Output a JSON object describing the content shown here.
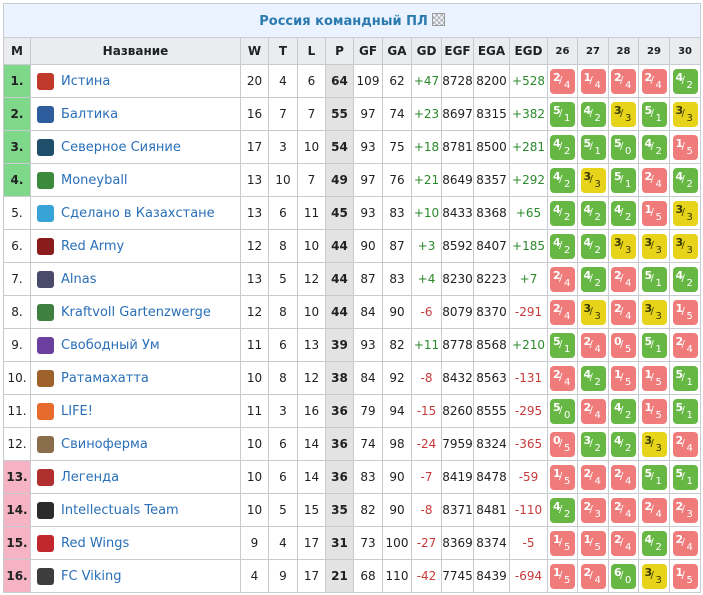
{
  "title": "Россия командный ПЛ",
  "columns": [
    "М",
    "Название",
    "W",
    "T",
    "L",
    "P",
    "GF",
    "GA",
    "GD",
    "EGF",
    "EGA",
    "EGD",
    "26",
    "27",
    "28",
    "29",
    "30"
  ],
  "colors": {
    "win": "#67b744",
    "draw": "#e6d31a",
    "loss": "#ef7b7b",
    "promotion": "#7fd78a",
    "relegation": "#f6b3c4",
    "link": "#2a6fb8"
  },
  "rows": [
    {
      "pos": "1.",
      "zone": "promo",
      "name": "Истина",
      "logo": "#c0392b",
      "W": "20",
      "T": "4",
      "L": "6",
      "P": "64",
      "GF": "109",
      "GA": "62",
      "GD": "+47",
      "EGF": "8728",
      "EGA": "8200",
      "EGD": "+528",
      "results": [
        {
          "a": "2",
          "b": "4",
          "r": "L"
        },
        {
          "a": "1",
          "b": "4",
          "r": "L"
        },
        {
          "a": "2",
          "b": "4",
          "r": "L"
        },
        {
          "a": "2",
          "b": "4",
          "r": "L"
        },
        {
          "a": "4",
          "b": "2",
          "r": "W"
        }
      ]
    },
    {
      "pos": "2.",
      "zone": "promo",
      "name": "Балтика",
      "logo": "#2e5d9e",
      "W": "16",
      "T": "7",
      "L": "7",
      "P": "55",
      "GF": "97",
      "GA": "74",
      "GD": "+23",
      "EGF": "8697",
      "EGA": "8315",
      "EGD": "+382",
      "results": [
        {
          "a": "5",
          "b": "1",
          "r": "W"
        },
        {
          "a": "4",
          "b": "2",
          "r": "W"
        },
        {
          "a": "3",
          "b": "3",
          "r": "D"
        },
        {
          "a": "5",
          "b": "1",
          "r": "W"
        },
        {
          "a": "3",
          "b": "3",
          "r": "D"
        }
      ]
    },
    {
      "pos": "3.",
      "zone": "promo",
      "name": "Северное Сияние",
      "logo": "#1f4f6b",
      "W": "17",
      "T": "3",
      "L": "10",
      "P": "54",
      "GF": "93",
      "GA": "75",
      "GD": "+18",
      "EGF": "8781",
      "EGA": "8500",
      "EGD": "+281",
      "results": [
        {
          "a": "4",
          "b": "2",
          "r": "W"
        },
        {
          "a": "5",
          "b": "1",
          "r": "W"
        },
        {
          "a": "5",
          "b": "0",
          "r": "W"
        },
        {
          "a": "4",
          "b": "2",
          "r": "W"
        },
        {
          "a": "1",
          "b": "5",
          "r": "L"
        }
      ]
    },
    {
      "pos": "4.",
      "zone": "promo",
      "name": "Moneyball",
      "logo": "#3c8a3c",
      "W": "13",
      "T": "10",
      "L": "7",
      "P": "49",
      "GF": "97",
      "GA": "76",
      "GD": "+21",
      "EGF": "8649",
      "EGA": "8357",
      "EGD": "+292",
      "results": [
        {
          "a": "4",
          "b": "2",
          "r": "W"
        },
        {
          "a": "3",
          "b": "3",
          "r": "D"
        },
        {
          "a": "5",
          "b": "1",
          "r": "W"
        },
        {
          "a": "2",
          "b": "4",
          "r": "L"
        },
        {
          "a": "4",
          "b": "2",
          "r": "W"
        }
      ]
    },
    {
      "pos": "5.",
      "zone": "",
      "name": "Сделано в Казахстане",
      "logo": "#37a3d6",
      "W": "13",
      "T": "6",
      "L": "11",
      "P": "45",
      "GF": "93",
      "GA": "83",
      "GD": "+10",
      "EGF": "8433",
      "EGA": "8368",
      "EGD": "+65",
      "results": [
        {
          "a": "4",
          "b": "2",
          "r": "W"
        },
        {
          "a": "4",
          "b": "2",
          "r": "W"
        },
        {
          "a": "4",
          "b": "2",
          "r": "W"
        },
        {
          "a": "1",
          "b": "5",
          "r": "L"
        },
        {
          "a": "3",
          "b": "3",
          "r": "D"
        }
      ]
    },
    {
      "pos": "6.",
      "zone": "",
      "name": "Red Army",
      "logo": "#8a1c1c",
      "W": "12",
      "T": "8",
      "L": "10",
      "P": "44",
      "GF": "90",
      "GA": "87",
      "GD": "+3",
      "EGF": "8592",
      "EGA": "8407",
      "EGD": "+185",
      "results": [
        {
          "a": "4",
          "b": "2",
          "r": "W"
        },
        {
          "a": "4",
          "b": "2",
          "r": "W"
        },
        {
          "a": "3",
          "b": "3",
          "r": "D"
        },
        {
          "a": "3",
          "b": "3",
          "r": "D"
        },
        {
          "a": "3",
          "b": "3",
          "r": "D"
        }
      ]
    },
    {
      "pos": "7.",
      "zone": "",
      "name": "Alnas",
      "logo": "#4a4a6a",
      "W": "13",
      "T": "5",
      "L": "12",
      "P": "44",
      "GF": "87",
      "GA": "83",
      "GD": "+4",
      "EGF": "8230",
      "EGA": "8223",
      "EGD": "+7",
      "results": [
        {
          "a": "2",
          "b": "4",
          "r": "L"
        },
        {
          "a": "4",
          "b": "2",
          "r": "W"
        },
        {
          "a": "2",
          "b": "4",
          "r": "L"
        },
        {
          "a": "5",
          "b": "1",
          "r": "W"
        },
        {
          "a": "4",
          "b": "2",
          "r": "W"
        }
      ]
    },
    {
      "pos": "8.",
      "zone": "",
      "name": "Kraftvoll Gartenzwerge",
      "logo": "#3f7f3f",
      "W": "12",
      "T": "8",
      "L": "10",
      "P": "44",
      "GF": "84",
      "GA": "90",
      "GD": "-6",
      "EGF": "8079",
      "EGA": "8370",
      "EGD": "-291",
      "results": [
        {
          "a": "2",
          "b": "4",
          "r": "L"
        },
        {
          "a": "3",
          "b": "3",
          "r": "D"
        },
        {
          "a": "2",
          "b": "4",
          "r": "L"
        },
        {
          "a": "3",
          "b": "3",
          "r": "D"
        },
        {
          "a": "1",
          "b": "5",
          "r": "L"
        }
      ]
    },
    {
      "pos": "9.",
      "zone": "",
      "name": "Свободный Ум",
      "logo": "#6b3f9e",
      "W": "11",
      "T": "6",
      "L": "13",
      "P": "39",
      "GF": "93",
      "GA": "82",
      "GD": "+11",
      "EGF": "8778",
      "EGA": "8568",
      "EGD": "+210",
      "results": [
        {
          "a": "5",
          "b": "1",
          "r": "W"
        },
        {
          "a": "2",
          "b": "4",
          "r": "L"
        },
        {
          "a": "0",
          "b": "5",
          "r": "L"
        },
        {
          "a": "5",
          "b": "1",
          "r": "W"
        },
        {
          "a": "2",
          "b": "4",
          "r": "L"
        }
      ]
    },
    {
      "pos": "10.",
      "zone": "",
      "name": "Ратамахатта",
      "logo": "#a0622d",
      "W": "10",
      "T": "8",
      "L": "12",
      "P": "38",
      "GF": "84",
      "GA": "92",
      "GD": "-8",
      "EGF": "8432",
      "EGA": "8563",
      "EGD": "-131",
      "results": [
        {
          "a": "2",
          "b": "4",
          "r": "L"
        },
        {
          "a": "4",
          "b": "2",
          "r": "W"
        },
        {
          "a": "1",
          "b": "5",
          "r": "L"
        },
        {
          "a": "1",
          "b": "5",
          "r": "L"
        },
        {
          "a": "5",
          "b": "1",
          "r": "W"
        }
      ]
    },
    {
      "pos": "11.",
      "zone": "",
      "name": "LIFE!",
      "logo": "#e86b2e",
      "W": "11",
      "T": "3",
      "L": "16",
      "P": "36",
      "GF": "79",
      "GA": "94",
      "GD": "-15",
      "EGF": "8260",
      "EGA": "8555",
      "EGD": "-295",
      "results": [
        {
          "a": "5",
          "b": "0",
          "r": "W"
        },
        {
          "a": "2",
          "b": "4",
          "r": "L"
        },
        {
          "a": "4",
          "b": "2",
          "r": "W"
        },
        {
          "a": "1",
          "b": "5",
          "r": "L"
        },
        {
          "a": "5",
          "b": "1",
          "r": "W"
        }
      ]
    },
    {
      "pos": "12.",
      "zone": "",
      "name": "Свиноферма",
      "logo": "#8a6d4a",
      "W": "10",
      "T": "6",
      "L": "14",
      "P": "36",
      "GF": "74",
      "GA": "98",
      "GD": "-24",
      "EGF": "7959",
      "EGA": "8324",
      "EGD": "-365",
      "results": [
        {
          "a": "0",
          "b": "5",
          "r": "L"
        },
        {
          "a": "3",
          "b": "2",
          "r": "W"
        },
        {
          "a": "4",
          "b": "2",
          "r": "W"
        },
        {
          "a": "3",
          "b": "3",
          "r": "D"
        },
        {
          "a": "2",
          "b": "4",
          "r": "L"
        }
      ]
    },
    {
      "pos": "13.",
      "zone": "releg",
      "name": "Легенда",
      "logo": "#b03030",
      "W": "10",
      "T": "6",
      "L": "14",
      "P": "36",
      "GF": "83",
      "GA": "90",
      "GD": "-7",
      "EGF": "8419",
      "EGA": "8478",
      "EGD": "-59",
      "results": [
        {
          "a": "1",
          "b": "5",
          "r": "L"
        },
        {
          "a": "2",
          "b": "4",
          "r": "L"
        },
        {
          "a": "2",
          "b": "4",
          "r": "L"
        },
        {
          "a": "5",
          "b": "1",
          "r": "W"
        },
        {
          "a": "5",
          "b": "1",
          "r": "W"
        }
      ]
    },
    {
      "pos": "14.",
      "zone": "releg",
      "name": "Intellectuals Team",
      "logo": "#2b2b2b",
      "W": "10",
      "T": "5",
      "L": "15",
      "P": "35",
      "GF": "82",
      "GA": "90",
      "GD": "-8",
      "EGF": "8371",
      "EGA": "8481",
      "EGD": "-110",
      "results": [
        {
          "a": "4",
          "b": "2",
          "r": "W"
        },
        {
          "a": "2",
          "b": "3",
          "r": "L"
        },
        {
          "a": "2",
          "b": "4",
          "r": "L"
        },
        {
          "a": "2",
          "b": "4",
          "r": "L"
        },
        {
          "a": "2",
          "b": "3",
          "r": "L"
        }
      ]
    },
    {
      "pos": "15.",
      "zone": "releg",
      "name": "Red Wings",
      "logo": "#c0282d",
      "W": "9",
      "T": "4",
      "L": "17",
      "P": "31",
      "GF": "73",
      "GA": "100",
      "GD": "-27",
      "EGF": "8369",
      "EGA": "8374",
      "EGD": "-5",
      "results": [
        {
          "a": "1",
          "b": "5",
          "r": "L"
        },
        {
          "a": "1",
          "b": "5",
          "r": "L"
        },
        {
          "a": "2",
          "b": "4",
          "r": "L"
        },
        {
          "a": "4",
          "b": "2",
          "r": "W"
        },
        {
          "a": "2",
          "b": "4",
          "r": "L"
        }
      ]
    },
    {
      "pos": "16.",
      "zone": "releg",
      "name": "FC Viking",
      "logo": "#3d3d3d",
      "W": "4",
      "T": "9",
      "L": "17",
      "P": "21",
      "GF": "68",
      "GA": "110",
      "GD": "-42",
      "EGF": "7745",
      "EGA": "8439",
      "EGD": "-694",
      "results": [
        {
          "a": "1",
          "b": "5",
          "r": "L"
        },
        {
          "a": "2",
          "b": "4",
          "r": "L"
        },
        {
          "a": "6",
          "b": "0",
          "r": "W"
        },
        {
          "a": "3",
          "b": "3",
          "r": "D"
        },
        {
          "a": "1",
          "b": "5",
          "r": "L"
        }
      ]
    }
  ]
}
